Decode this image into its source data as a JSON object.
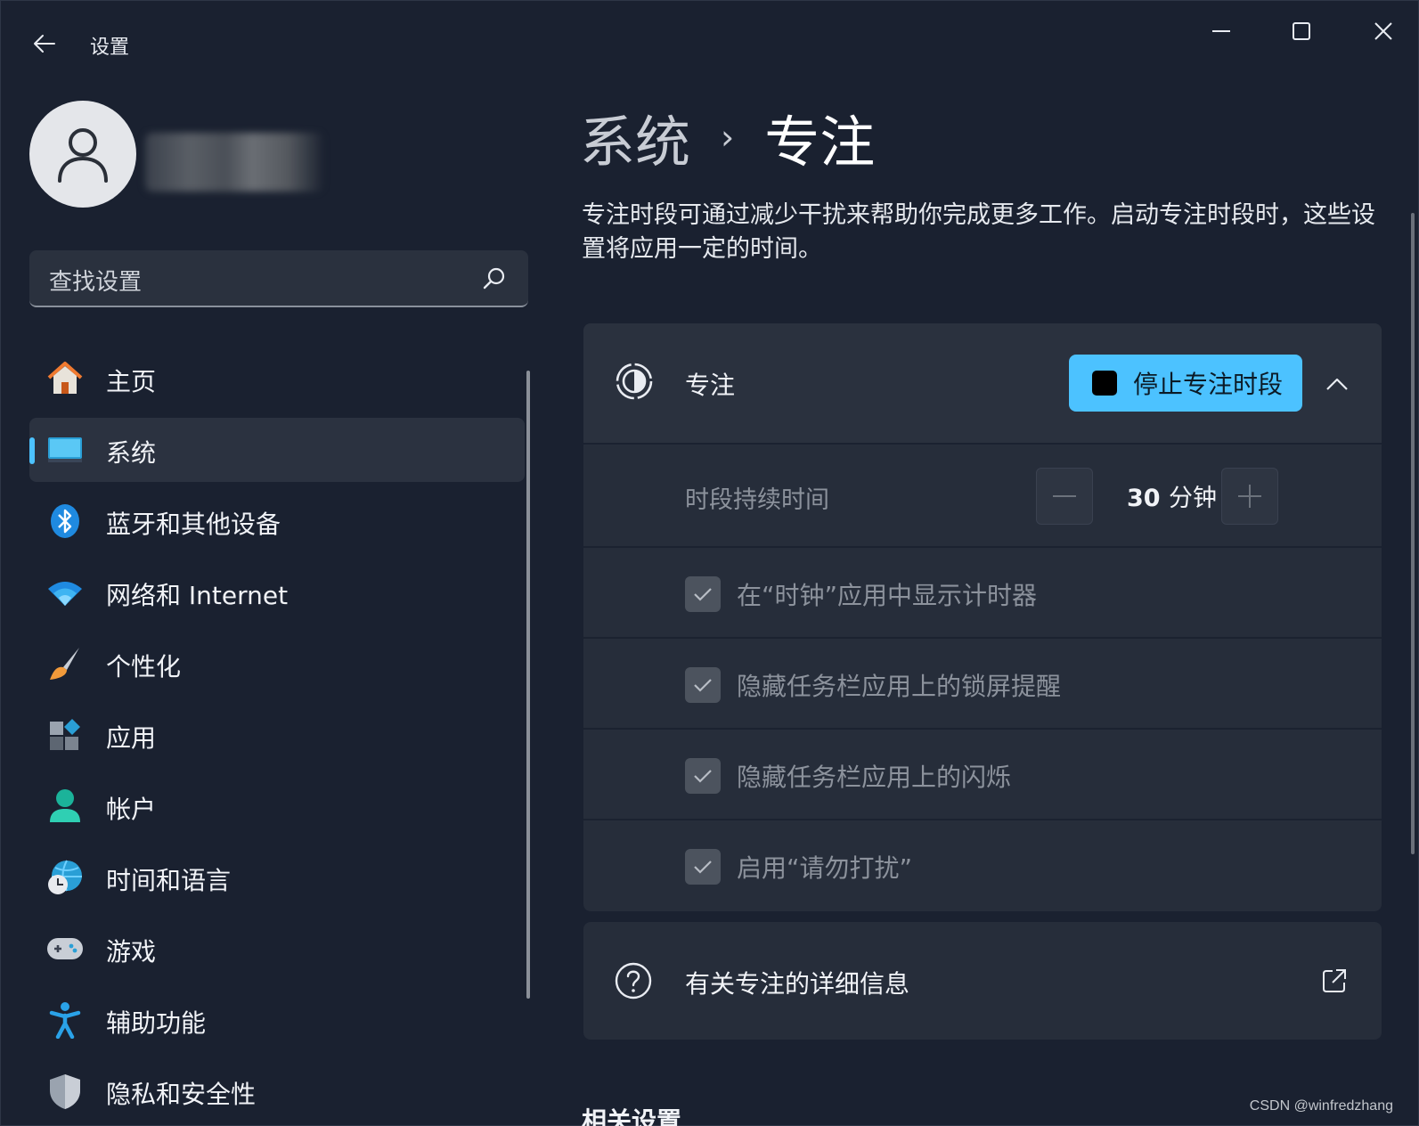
{
  "window": {
    "title": "设置"
  },
  "sidebar": {
    "search_placeholder": "查找设置",
    "items": [
      {
        "label": "主页",
        "icon": "home-icon"
      },
      {
        "label": "系统",
        "icon": "system-monitor-icon",
        "active": true
      },
      {
        "label": "蓝牙和其他设备",
        "icon": "bluetooth-icon"
      },
      {
        "label": "网络和 Internet",
        "icon": "wifi-icon"
      },
      {
        "label": "个性化",
        "icon": "brush-icon"
      },
      {
        "label": "应用",
        "icon": "apps-icon"
      },
      {
        "label": "帐户",
        "icon": "account-icon"
      },
      {
        "label": "时间和语言",
        "icon": "globe-clock-icon"
      },
      {
        "label": "游戏",
        "icon": "gamepad-icon"
      },
      {
        "label": "辅助功能",
        "icon": "accessibility-icon"
      },
      {
        "label": "隐私和安全性",
        "icon": "shield-icon"
      }
    ]
  },
  "main": {
    "breadcrumb": {
      "parent": "系统",
      "separator": "›",
      "current": "专注"
    },
    "description": "专注时段可通过减少干扰来帮助你完成更多工作。启动专注时段时，这些设置将应用一定的时间。",
    "focus": {
      "label": "专注",
      "stop_button": "停止专注时段",
      "duration_label": "时段持续时间",
      "duration_value": "30",
      "duration_unit": "分钟",
      "options": [
        {
          "label": "在“时钟”应用中显示计时器",
          "checked": true
        },
        {
          "label": "隐藏任务栏应用上的锁屏提醒",
          "checked": true
        },
        {
          "label": "隐藏任务栏应用上的闪烁",
          "checked": true
        },
        {
          "label": "启用“请勿打扰”",
          "checked": true
        }
      ]
    },
    "info_link": "有关专注的详细信息",
    "related_heading": "相关设置"
  },
  "watermark": "CSDN @winfredzhang",
  "colors": {
    "accent": "#4cc2ff",
    "background": "#1a2130",
    "card": "#262d3a"
  }
}
